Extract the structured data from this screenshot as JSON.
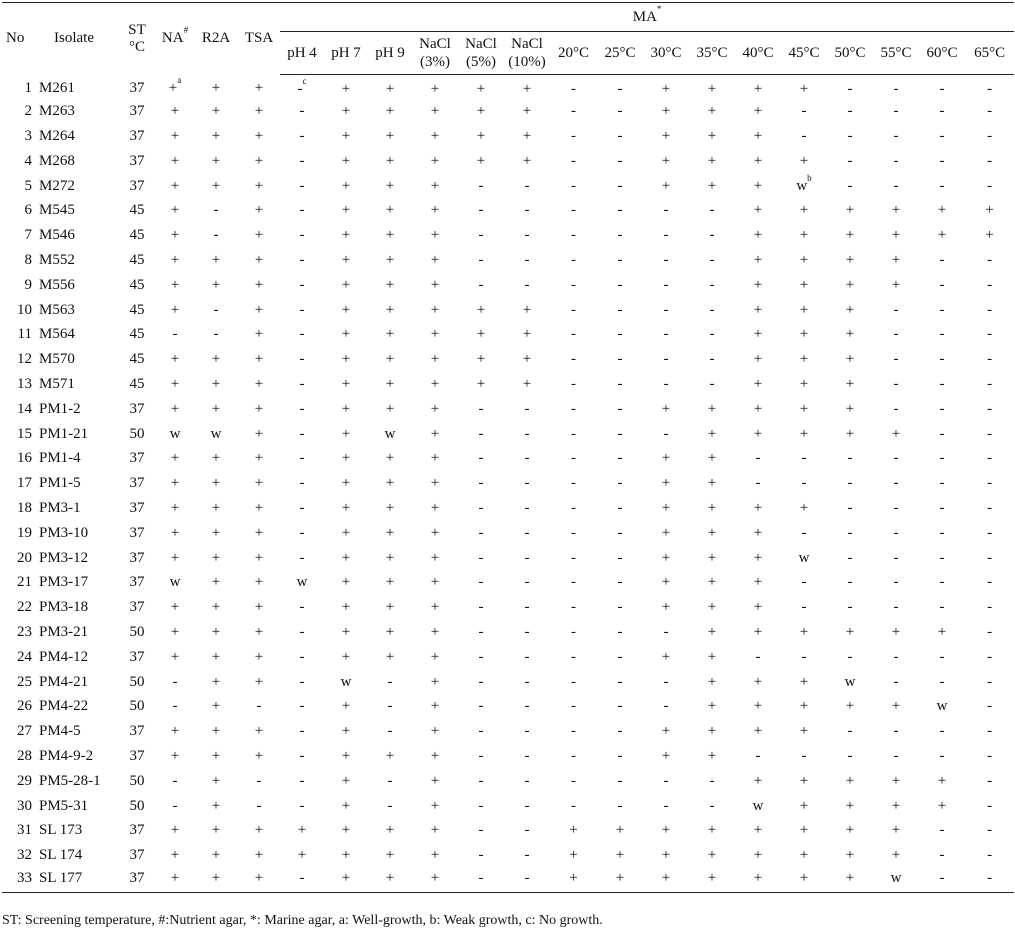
{
  "header": {
    "no": "No",
    "isolate": "Isolate",
    "st_line1": "ST",
    "st_line2": "°C",
    "na": "NA",
    "na_mark": "#",
    "r2a": "R2A",
    "tsa": "TSA",
    "ma": "MA",
    "ma_mark": "*",
    "ma_columns": [
      [
        "pH 4"
      ],
      [
        "pH 7"
      ],
      [
        "pH 9"
      ],
      [
        "NaCl",
        "(3%)"
      ],
      [
        "NaCl",
        "(5%)"
      ],
      [
        "NaCl",
        "(10%)"
      ],
      [
        "20°C"
      ],
      [
        "25°C"
      ],
      [
        "30°C"
      ],
      [
        "35°C"
      ],
      [
        "40°C"
      ],
      [
        "45°C"
      ],
      [
        "50°C"
      ],
      [
        "55°C"
      ],
      [
        "60°C"
      ],
      [
        "65°C"
      ]
    ]
  },
  "rows": [
    {
      "no": "1",
      "isolate": "M261",
      "st": "37",
      "values": [
        "+",
        "+",
        "+",
        "-",
        "+",
        "+",
        "+",
        "+",
        "+",
        "-",
        "-",
        "+",
        "+",
        "+",
        "+",
        "-",
        "-",
        "-",
        "-"
      ],
      "marks": {
        "0": "a",
        "3": "c"
      }
    },
    {
      "no": "2",
      "isolate": "M263",
      "st": "37",
      "values": [
        "+",
        "+",
        "+",
        "-",
        "+",
        "+",
        "+",
        "+",
        "+",
        "-",
        "-",
        "+",
        "+",
        "+",
        "-",
        "-",
        "-",
        "-",
        "-"
      ]
    },
    {
      "no": "3",
      "isolate": "M264",
      "st": "37",
      "values": [
        "+",
        "+",
        "+",
        "-",
        "+",
        "+",
        "+",
        "+",
        "+",
        "-",
        "-",
        "+",
        "+",
        "+",
        "-",
        "-",
        "-",
        "-",
        "-"
      ]
    },
    {
      "no": "4",
      "isolate": "M268",
      "st": "37",
      "values": [
        "+",
        "+",
        "+",
        "-",
        "+",
        "+",
        "+",
        "+",
        "+",
        "-",
        "-",
        "+",
        "+",
        "+",
        "+",
        "-",
        "-",
        "-",
        "-"
      ]
    },
    {
      "no": "5",
      "isolate": "M272",
      "st": "37",
      "values": [
        "+",
        "+",
        "+",
        "-",
        "+",
        "+",
        "+",
        "-",
        "-",
        "-",
        "-",
        "+",
        "+",
        "+",
        "w",
        "-",
        "-",
        "-",
        "-"
      ],
      "marks": {
        "14": "b"
      }
    },
    {
      "no": "6",
      "isolate": "M545",
      "st": "45",
      "values": [
        "+",
        "-",
        "+",
        "-",
        "+",
        "+",
        "+",
        "-",
        "-",
        "-",
        "-",
        "-",
        "-",
        "+",
        "+",
        "+",
        "+",
        "+",
        "+"
      ]
    },
    {
      "no": "7",
      "isolate": "M546",
      "st": "45",
      "values": [
        "+",
        "-",
        "+",
        "-",
        "+",
        "+",
        "+",
        "-",
        "-",
        "-",
        "-",
        "-",
        "-",
        "+",
        "+",
        "+",
        "+",
        "+",
        "+"
      ]
    },
    {
      "no": "8",
      "isolate": "M552",
      "st": "45",
      "values": [
        "+",
        "+",
        "+",
        "-",
        "+",
        "+",
        "+",
        "-",
        "-",
        "-",
        "-",
        "-",
        "-",
        "+",
        "+",
        "+",
        "+",
        "-",
        "-"
      ]
    },
    {
      "no": "9",
      "isolate": "M556",
      "st": "45",
      "values": [
        "+",
        "+",
        "+",
        "-",
        "+",
        "+",
        "+",
        "-",
        "-",
        "-",
        "-",
        "-",
        "-",
        "+",
        "+",
        "+",
        "+",
        "-",
        "-"
      ]
    },
    {
      "no": "10",
      "isolate": "M563",
      "st": "45",
      "values": [
        "+",
        "-",
        "+",
        "-",
        "+",
        "+",
        "+",
        "+",
        "+",
        "-",
        "-",
        "-",
        "-",
        "+",
        "+",
        "+",
        "-",
        "-",
        "-"
      ]
    },
    {
      "no": "11",
      "isolate": "M564",
      "st": "45",
      "values": [
        "-",
        "-",
        "+",
        "-",
        "+",
        "+",
        "+",
        "+",
        "+",
        "-",
        "-",
        "-",
        "-",
        "+",
        "+",
        "+",
        "-",
        "-",
        "-"
      ]
    },
    {
      "no": "12",
      "isolate": "M570",
      "st": "45",
      "values": [
        "+",
        "+",
        "+",
        "-",
        "+",
        "+",
        "+",
        "+",
        "+",
        "-",
        "-",
        "-",
        "-",
        "+",
        "+",
        "+",
        "-",
        "-",
        "-"
      ]
    },
    {
      "no": "13",
      "isolate": "M571",
      "st": "45",
      "values": [
        "+",
        "+",
        "+",
        "-",
        "+",
        "+",
        "+",
        "+",
        "+",
        "-",
        "-",
        "-",
        "-",
        "+",
        "+",
        "+",
        "-",
        "-",
        "-"
      ]
    },
    {
      "no": "14",
      "isolate": "PM1-2",
      "st": "37",
      "values": [
        "+",
        "+",
        "+",
        "-",
        "+",
        "+",
        "+",
        "-",
        "-",
        "-",
        "-",
        "+",
        "+",
        "+",
        "+",
        "+",
        "-",
        "-",
        "-"
      ]
    },
    {
      "no": "15",
      "isolate": "PM1-21",
      "st": "50",
      "values": [
        "w",
        "w",
        "+",
        "-",
        "+",
        "w",
        "+",
        "-",
        "-",
        "-",
        "-",
        "-",
        "+",
        "+",
        "+",
        "+",
        "+",
        "-",
        "-"
      ]
    },
    {
      "no": "16",
      "isolate": "PM1-4",
      "st": "37",
      "values": [
        "+",
        "+",
        "+",
        "-",
        "+",
        "+",
        "+",
        "-",
        "-",
        "-",
        "-",
        "+",
        "+",
        "-",
        "-",
        "-",
        "-",
        "-",
        "-"
      ]
    },
    {
      "no": "17",
      "isolate": "PM1-5",
      "st": "37",
      "values": [
        "+",
        "+",
        "+",
        "-",
        "+",
        "+",
        "+",
        "-",
        "-",
        "-",
        "-",
        "+",
        "+",
        "-",
        "-",
        "-",
        "-",
        "-",
        "-"
      ]
    },
    {
      "no": "18",
      "isolate": "PM3-1",
      "st": "37",
      "values": [
        "+",
        "+",
        "+",
        "-",
        "+",
        "+",
        "+",
        "-",
        "-",
        "-",
        "-",
        "+",
        "+",
        "+",
        "+",
        "-",
        "-",
        "-",
        "-"
      ]
    },
    {
      "no": "19",
      "isolate": "PM3-10",
      "st": "37",
      "values": [
        "+",
        "+",
        "+",
        "-",
        "+",
        "+",
        "+",
        "-",
        "-",
        "-",
        "-",
        "+",
        "+",
        "+",
        "-",
        "-",
        "-",
        "-",
        "-"
      ]
    },
    {
      "no": "20",
      "isolate": "PM3-12",
      "st": "37",
      "values": [
        "+",
        "+",
        "+",
        "-",
        "+",
        "+",
        "+",
        "-",
        "-",
        "-",
        "-",
        "+",
        "+",
        "+",
        "w",
        "-",
        "-",
        "-",
        "-"
      ]
    },
    {
      "no": "21",
      "isolate": "PM3-17",
      "st": "37",
      "values": [
        "w",
        "+",
        "+",
        "w",
        "+",
        "+",
        "+",
        "-",
        "-",
        "-",
        "-",
        "+",
        "+",
        "+",
        "-",
        "-",
        "-",
        "-",
        "-"
      ]
    },
    {
      "no": "22",
      "isolate": "PM3-18",
      "st": "37",
      "values": [
        "+",
        "+",
        "+",
        "-",
        "+",
        "+",
        "+",
        "-",
        "-",
        "-",
        "-",
        "+",
        "+",
        "+",
        "-",
        "-",
        "-",
        "-",
        "-"
      ]
    },
    {
      "no": "23",
      "isolate": "PM3-21",
      "st": "50",
      "values": [
        "+",
        "+",
        "+",
        "-",
        "+",
        "+",
        "+",
        "-",
        "-",
        "-",
        "-",
        "-",
        "+",
        "+",
        "+",
        "+",
        "+",
        "+",
        "-"
      ]
    },
    {
      "no": "24",
      "isolate": "PM4-12",
      "st": "37",
      "values": [
        "+",
        "+",
        "+",
        "-",
        "+",
        "+",
        "+",
        "-",
        "-",
        "-",
        "-",
        "+",
        "+",
        "-",
        "-",
        "-",
        "-",
        "-",
        "-"
      ]
    },
    {
      "no": "25",
      "isolate": "PM4-21",
      "st": "50",
      "values": [
        "-",
        "+",
        "+",
        "-",
        "w",
        "-",
        "+",
        "-",
        "-",
        "-",
        "-",
        "-",
        "+",
        "+",
        "+",
        "w",
        "-",
        "-",
        "-"
      ]
    },
    {
      "no": "26",
      "isolate": "PM4-22",
      "st": "50",
      "values": [
        "-",
        "+",
        "-",
        "-",
        "+",
        "-",
        "+",
        "-",
        "-",
        "-",
        "-",
        "-",
        "+",
        "+",
        "+",
        "+",
        "+",
        "w",
        "-"
      ]
    },
    {
      "no": "27",
      "isolate": "PM4-5",
      "st": "37",
      "values": [
        "+",
        "+",
        "+",
        "-",
        "+",
        "-",
        "+",
        "-",
        "-",
        "-",
        "-",
        "+",
        "+",
        "+",
        "+",
        "-",
        "-",
        "-",
        "-"
      ]
    },
    {
      "no": "28",
      "isolate": "PM4-9-2",
      "st": "37",
      "values": [
        "+",
        "+",
        "+",
        "-",
        "+",
        "+",
        "+",
        "-",
        "-",
        "-",
        "-",
        "+",
        "+",
        "-",
        "-",
        "-",
        "-",
        "-",
        "-"
      ]
    },
    {
      "no": "29",
      "isolate": "PM5-28-1",
      "st": "50",
      "values": [
        "-",
        "+",
        "-",
        "-",
        "+",
        "-",
        "+",
        "-",
        "-",
        "-",
        "-",
        "-",
        "-",
        "+",
        "+",
        "+",
        "+",
        "+",
        "-"
      ]
    },
    {
      "no": "30",
      "isolate": "PM5-31",
      "st": "50",
      "values": [
        "-",
        "+",
        "-",
        "-",
        "+",
        "-",
        "+",
        "-",
        "-",
        "-",
        "-",
        "-",
        "-",
        "w",
        "+",
        "+",
        "+",
        "+",
        "-"
      ]
    },
    {
      "no": "31",
      "isolate": "SL 173",
      "st": "37",
      "values": [
        "+",
        "+",
        "+",
        "+",
        "+",
        "+",
        "+",
        "-",
        "-",
        "+",
        "+",
        "+",
        "+",
        "+",
        "+",
        "+",
        "+",
        "-",
        "-"
      ]
    },
    {
      "no": "32",
      "isolate": "SL 174",
      "st": "37",
      "values": [
        "+",
        "+",
        "+",
        "+",
        "+",
        "+",
        "+",
        "-",
        "-",
        "+",
        "+",
        "+",
        "+",
        "+",
        "+",
        "+",
        "+",
        "-",
        "-"
      ]
    },
    {
      "no": "33",
      "isolate": "SL 177",
      "st": "37",
      "values": [
        "+",
        "+",
        "+",
        "-",
        "+",
        "+",
        "+",
        "-",
        "-",
        "+",
        "+",
        "+",
        "+",
        "+",
        "+",
        "+",
        "w",
        "-",
        "-"
      ]
    }
  ],
  "footnote": "ST: Screening temperature, #:Nutrient agar, *: Marine agar, a: Well-growth, b: Weak growth, c: No growth."
}
